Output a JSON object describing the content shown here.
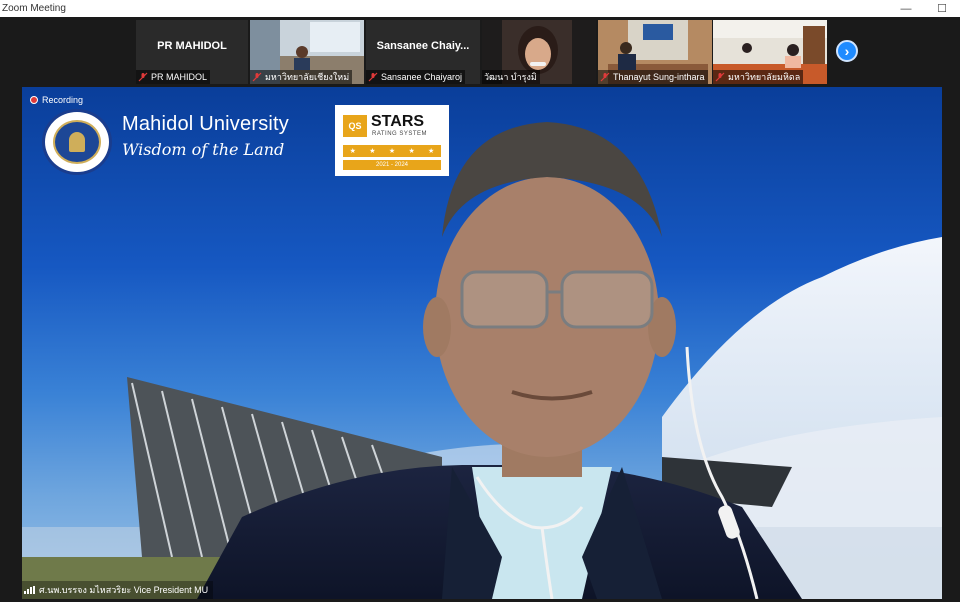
{
  "window": {
    "title": "Zoom Meeting",
    "minimize_icon": "minimize-icon",
    "maximize_icon": "maximize-icon"
  },
  "gallery": [
    {
      "name_plate": "PR MAHIDOL",
      "caption": "PR MAHIDOL",
      "muted": true
    },
    {
      "name_plate": "",
      "caption": "มหาวิทยาลัยเชียงใหม่",
      "muted": true
    },
    {
      "name_plate": "Sansanee  Chaiy...",
      "caption": "Sansanee Chaiyaroj",
      "muted": true
    },
    {
      "name_plate": "",
      "caption": "วัฒนา บำรุงมิ",
      "muted": false
    },
    {
      "name_plate": "",
      "caption": "Thanayut Sung-inthara",
      "muted": true
    },
    {
      "name_plate": "",
      "caption": "มหาวิทยาลัยมหิดล",
      "muted": true
    }
  ],
  "next_page_icon": "chevron-right-icon",
  "main_video": {
    "recording_label": "Recording",
    "background_title": "Mahidol University",
    "background_motto": "Wisdom of the Land",
    "qs_badge": "QS",
    "qs_title": "STARS",
    "qs_subtitle": "RATING SYSTEM",
    "qs_years": "2021 - 2024",
    "speaker_label": "ศ.นพ.บรรจง มไหสวริยะ Vice President MU"
  },
  "colors": {
    "accent": "#1f8bff",
    "recording": "#e03a3a",
    "qs_gold": "#e8a51a",
    "mute_red": "#e03a3a"
  }
}
